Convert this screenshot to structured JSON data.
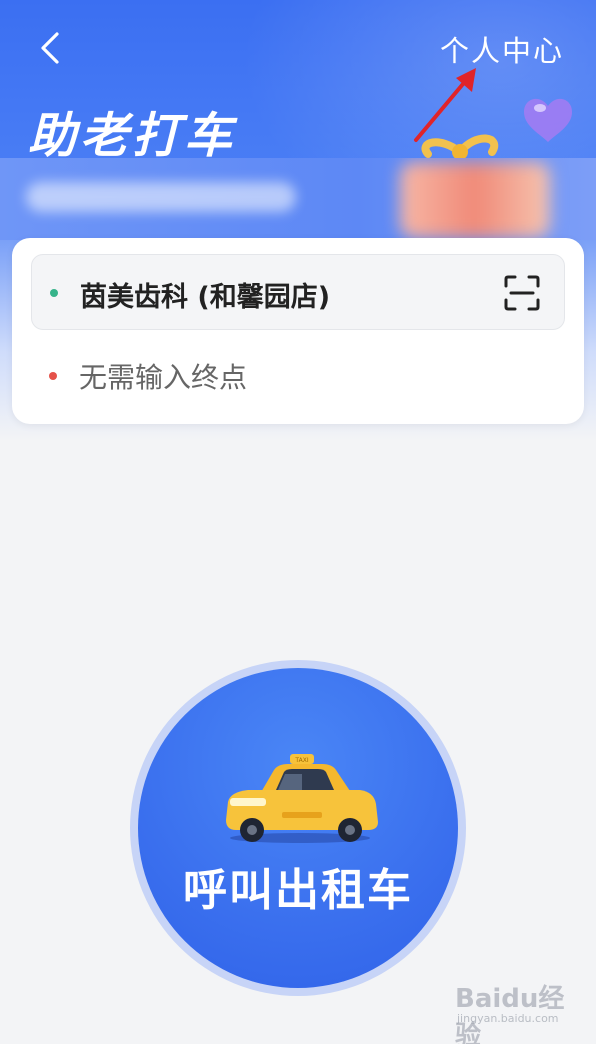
{
  "header": {
    "title": "助老打车",
    "personal_center": "个人中心",
    "back_icon": "chevron-left-icon"
  },
  "route": {
    "start": "茵美齿科 (和馨园店)",
    "destination_placeholder": "无需输入终点",
    "scan_icon": "scan-icon"
  },
  "call": {
    "label": "呼叫出租车",
    "taxi_icon": "taxi-icon"
  },
  "watermark": {
    "logo": "Baidu经验",
    "url": "jingyan.baidu.com"
  },
  "colors": {
    "primary": "#3b6ff2",
    "start_dot": "#36b38a",
    "destination_dot": "#e5524a",
    "annotation_arrow": "#e0242a"
  }
}
